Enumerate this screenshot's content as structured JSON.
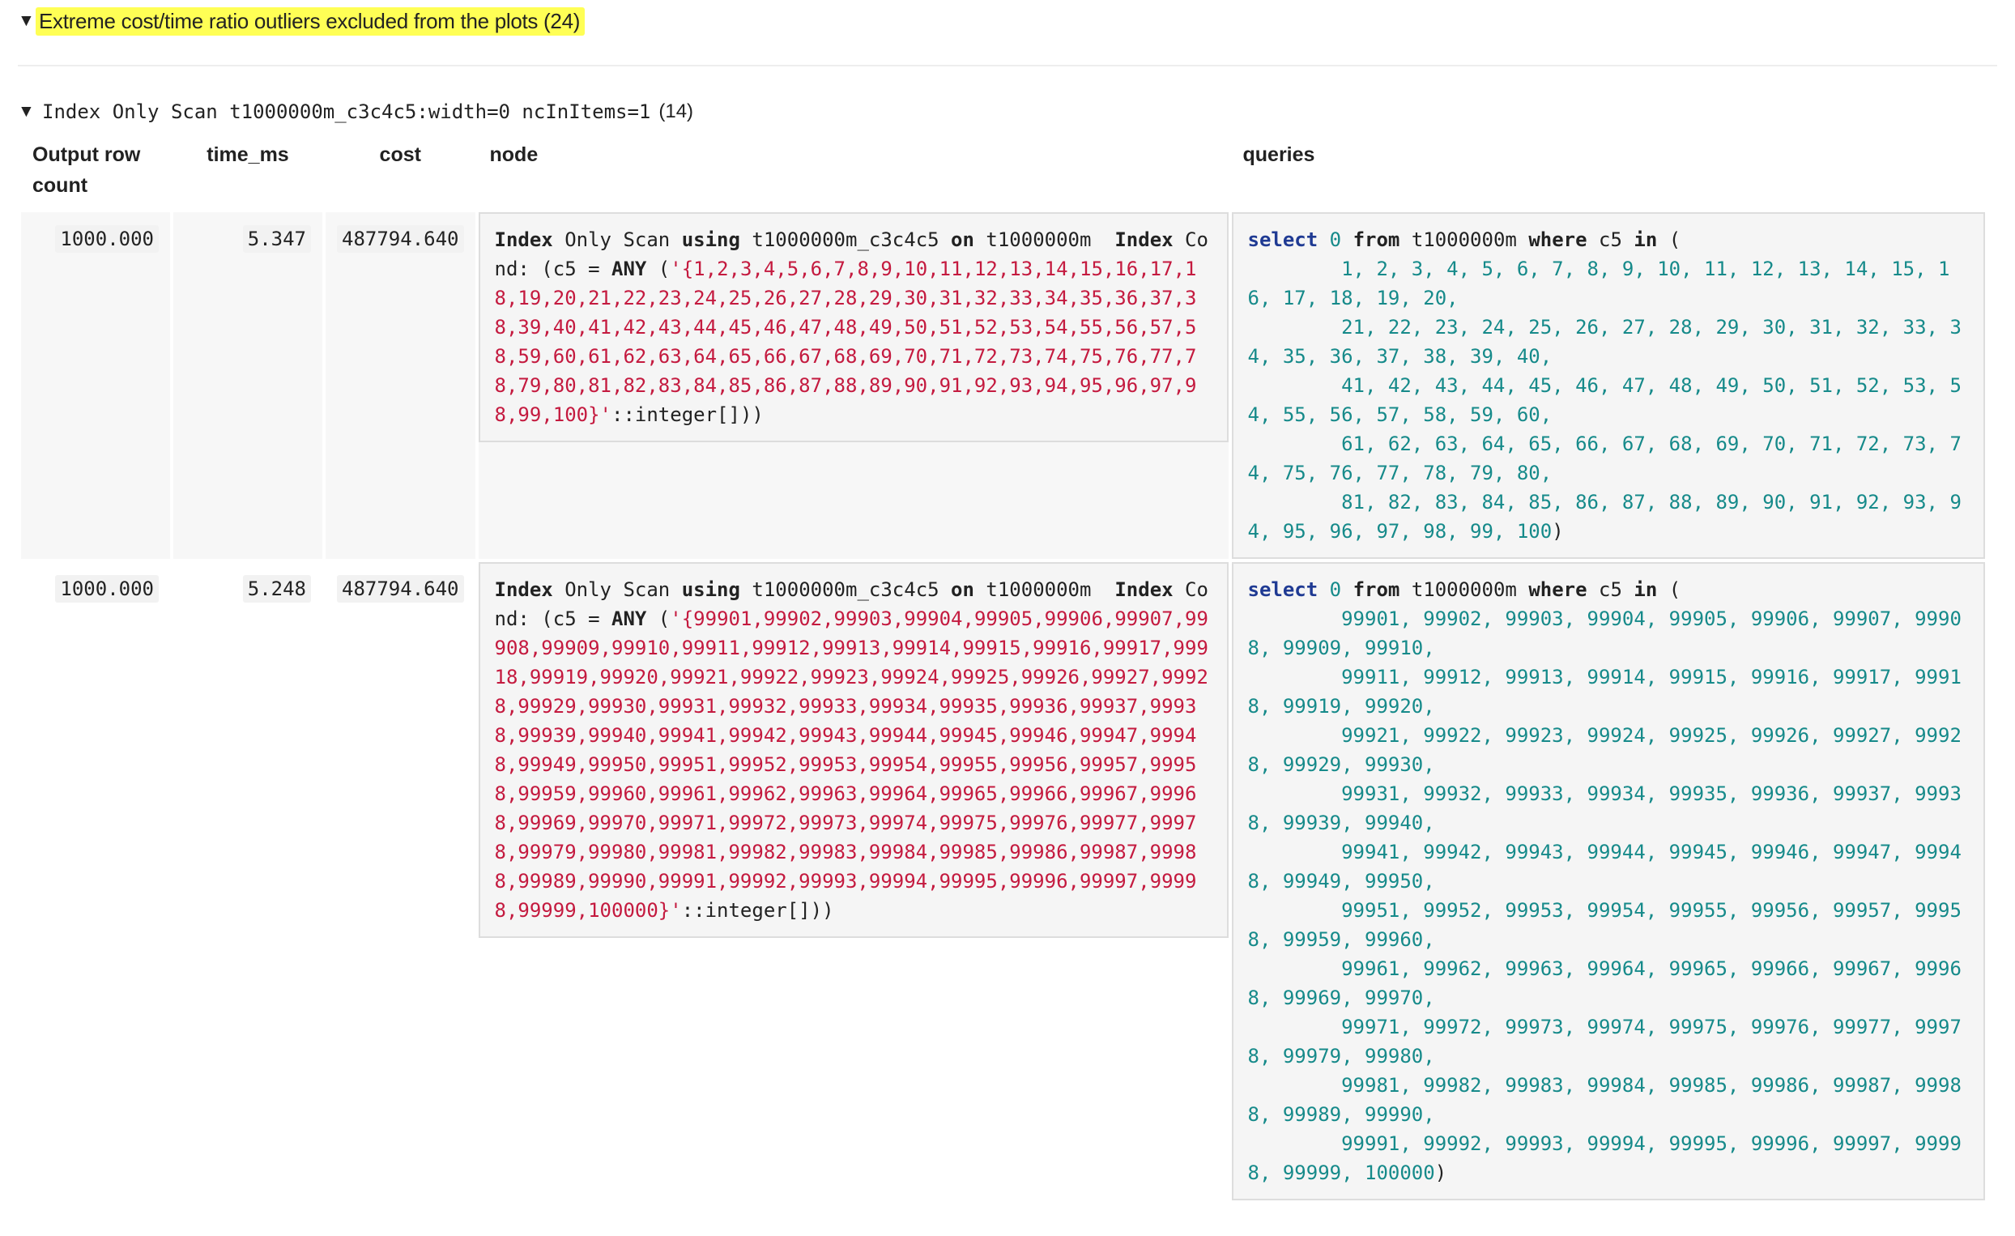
{
  "outliers": {
    "label": "Extreme cost/time ratio outliers excluded from the plots (24)"
  },
  "group": {
    "title": "Index Only Scan t1000000m_c3c4c5:width=0 ncInItems=1",
    "count": "(14)"
  },
  "table": {
    "headers": {
      "rows": "Output row count",
      "time": "time_ms",
      "cost": "cost",
      "node": "node",
      "queries": "queries"
    },
    "rows": [
      {
        "rows": "1000.000",
        "time": "5.347",
        "cost": "487794.640",
        "node": {
          "kw1": "Index",
          "t1": " Only Scan ",
          "kw2": "using",
          "t2": " t1000000m_c3c4c5 ",
          "kw3": "on",
          "t3": " t1000000m  ",
          "kw4": "Index",
          "t4": " Cond: (c5 = ",
          "kw5": "ANY",
          "t5": " (",
          "literal": "'{1,2,3,4,5,6,7,8,9,10,11,12,13,14,15,16,17,18,19,20,21,22,23,24,25,26,27,28,29,30,31,32,33,34,35,36,37,38,39,40,41,42,43,44,45,46,47,48,49,50,51,52,53,54,55,56,57,58,59,60,61,62,63,64,65,66,67,68,69,70,71,72,73,74,75,76,77,78,79,80,81,82,83,84,85,86,87,88,89,90,91,92,93,94,95,96,97,98,99,100}'",
          "tail": "::integer[]))"
        },
        "query": {
          "kw_select": "select",
          "zero": "0",
          "kw_from": "from",
          "table": "t1000000m",
          "kw_where": "where",
          "col": "c5",
          "kw_in": "in",
          "values": "1, 2, 3, 4, 5, 6, 7, 8, 9, 10, 11, 12, 13, 14, 15, 16, 17, 18, 19, 20,\n        21, 22, 23, 24, 25, 26, 27, 28, 29, 30, 31, 32, 33, 34, 35, 36, 37, 38, 39, 40,\n        41, 42, 43, 44, 45, 46, 47, 48, 49, 50, 51, 52, 53, 54, 55, 56, 57, 58, 59, 60,\n        61, 62, 63, 64, 65, 66, 67, 68, 69, 70, 71, 72, 73, 74, 75, 76, 77, 78, 79, 80,\n        81, 82, 83, 84, 85, 86, 87, 88, 89, 90, 91, 92, 93, 94, 95, 96, 97, 98, 99, 100"
        }
      },
      {
        "rows": "1000.000",
        "time": "5.248",
        "cost": "487794.640",
        "node": {
          "kw1": "Index",
          "t1": " Only Scan ",
          "kw2": "using",
          "t2": " t1000000m_c3c4c5 ",
          "kw3": "on",
          "t3": " t1000000m  ",
          "kw4": "Index",
          "t4": " Cond: (c5 = ",
          "kw5": "ANY",
          "t5": " (",
          "literal": "'{99901,99902,99903,99904,99905,99906,99907,99908,99909,99910,99911,99912,99913,99914,99915,99916,99917,99918,99919,99920,99921,99922,99923,99924,99925,99926,99927,99928,99929,99930,99931,99932,99933,99934,99935,99936,99937,99938,99939,99940,99941,99942,99943,99944,99945,99946,99947,99948,99949,99950,99951,99952,99953,99954,99955,99956,99957,99958,99959,99960,99961,99962,99963,99964,99965,99966,99967,99968,99969,99970,99971,99972,99973,99974,99975,99976,99977,99978,99979,99980,99981,99982,99983,99984,99985,99986,99987,99988,99989,99990,99991,99992,99993,99994,99995,99996,99997,99998,99999,100000}'",
          "tail": "::integer[]))"
        },
        "query": {
          "kw_select": "select",
          "zero": "0",
          "kw_from": "from",
          "table": "t1000000m",
          "kw_where": "where",
          "col": "c5",
          "kw_in": "in",
          "values": "99901, 99902, 99903, 99904, 99905, 99906, 99907, 99908, 99909, 99910,\n        99911, 99912, 99913, 99914, 99915, 99916, 99917, 99918, 99919, 99920,\n        99921, 99922, 99923, 99924, 99925, 99926, 99927, 99928, 99929, 99930,\n        99931, 99932, 99933, 99934, 99935, 99936, 99937, 99938, 99939, 99940,\n        99941, 99942, 99943, 99944, 99945, 99946, 99947, 99948, 99949, 99950,\n        99951, 99952, 99953, 99954, 99955, 99956, 99957, 99958, 99959, 99960,\n        99961, 99962, 99963, 99964, 99965, 99966, 99967, 99968, 99969, 99970,\n        99971, 99972, 99973, 99974, 99975, 99976, 99977, 99978, 99979, 99980,\n        99981, 99982, 99983, 99984, 99985, 99986, 99987, 99988, 99989, 99990,\n        99991, 99992, 99993, 99994, 99995, 99996, 99997, 99998, 99999, 100000"
        }
      }
    ]
  }
}
